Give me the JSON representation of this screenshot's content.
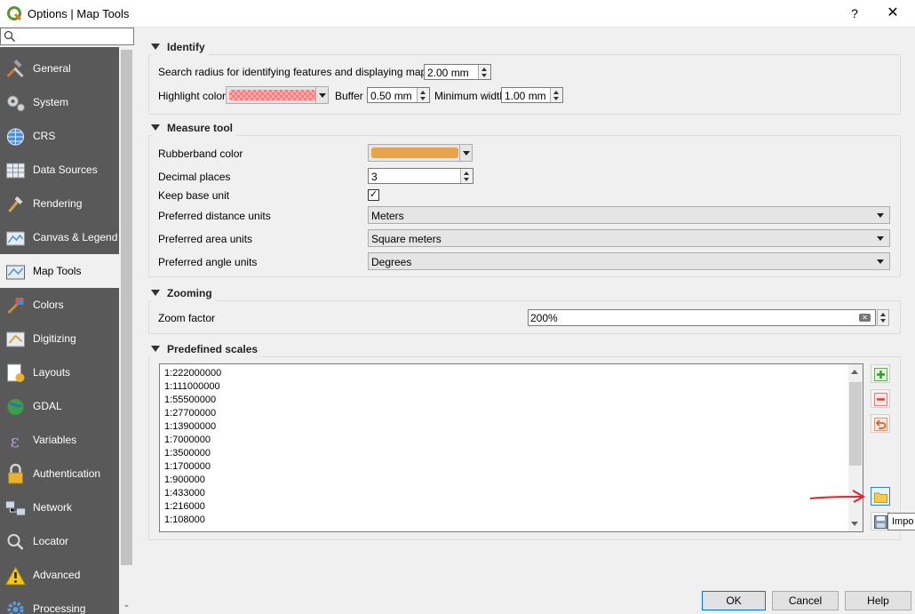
{
  "window": {
    "title": "Options | Map Tools",
    "help_label": "?",
    "close_label": "✕"
  },
  "sidebar": {
    "search_placeholder": "",
    "items": [
      {
        "label": "General",
        "icon": "hammer-wrench-icon",
        "active": false
      },
      {
        "label": "System",
        "icon": "gears-icon",
        "active": false
      },
      {
        "label": "CRS",
        "icon": "globe-grid-icon",
        "active": false
      },
      {
        "label": "Data Sources",
        "icon": "table-icon",
        "active": false
      },
      {
        "label": "Rendering",
        "icon": "paintbrush-icon",
        "active": false
      },
      {
        "label": "Canvas & Legend",
        "icon": "map-canvas-icon",
        "active": false
      },
      {
        "label": "Map Tools",
        "icon": "map-tools-icon",
        "active": true
      },
      {
        "label": "Colors",
        "icon": "colors-brush-icon",
        "active": false
      },
      {
        "label": "Digitizing",
        "icon": "digitizing-icon",
        "active": false
      },
      {
        "label": "Layouts",
        "icon": "layouts-icon",
        "active": false
      },
      {
        "label": "GDAL",
        "icon": "gdal-globe-icon",
        "active": false
      },
      {
        "label": "Variables",
        "icon": "epsilon-icon",
        "active": false
      },
      {
        "label": "Authentication",
        "icon": "padlock-icon",
        "active": false
      },
      {
        "label": "Network",
        "icon": "network-icon",
        "active": false
      },
      {
        "label": "Locator",
        "icon": "search-icon",
        "active": false
      },
      {
        "label": "Advanced",
        "icon": "warning-icon",
        "active": false
      },
      {
        "label": "Processing",
        "icon": "gear-icon",
        "active": false
      }
    ]
  },
  "identify": {
    "title": "Identify",
    "search_radius_label": "Search radius for identifying features and displaying map tips",
    "search_radius_value": "2.00 mm",
    "highlight_color_label": "Highlight color",
    "highlight_color": "#ff7a7a",
    "buffer_label": "Buffer",
    "buffer_value": "0.50 mm",
    "min_width_label": "Minimum width",
    "min_width_value": "1.00 mm"
  },
  "measure": {
    "title": "Measure tool",
    "rubberband_label": "Rubberband color",
    "rubberband_color": "#e8a34a",
    "decimal_label": "Decimal places",
    "decimal_value": "3",
    "keep_base_label": "Keep base unit",
    "keep_base_checked": true,
    "keep_base_mark": "✓",
    "distance_label": "Preferred distance units",
    "distance_value": "Meters",
    "area_label": "Preferred area units",
    "area_value": "Square meters",
    "angle_label": "Preferred angle units",
    "angle_value": "Degrees"
  },
  "zooming": {
    "title": "Zooming",
    "zoom_label": "Zoom factor",
    "zoom_value": "200%"
  },
  "scales": {
    "title": "Predefined scales",
    "items": [
      "1:222000000",
      "1:111000000",
      "1:55500000",
      "1:27700000",
      "1:13900000",
      "1:7000000",
      "1:3500000",
      "1:1700000",
      "1:900000",
      "1:433000",
      "1:216000",
      "1:108000"
    ],
    "tooltip": "Impo"
  },
  "buttons": {
    "ok": "OK",
    "cancel": "Cancel",
    "help": "Help"
  },
  "colors": {
    "sidebar_bg": "#595959",
    "annotation_arrow": "#e2232a",
    "add_green": "#2f9a2f",
    "remove_red": "#d43c3c"
  }
}
